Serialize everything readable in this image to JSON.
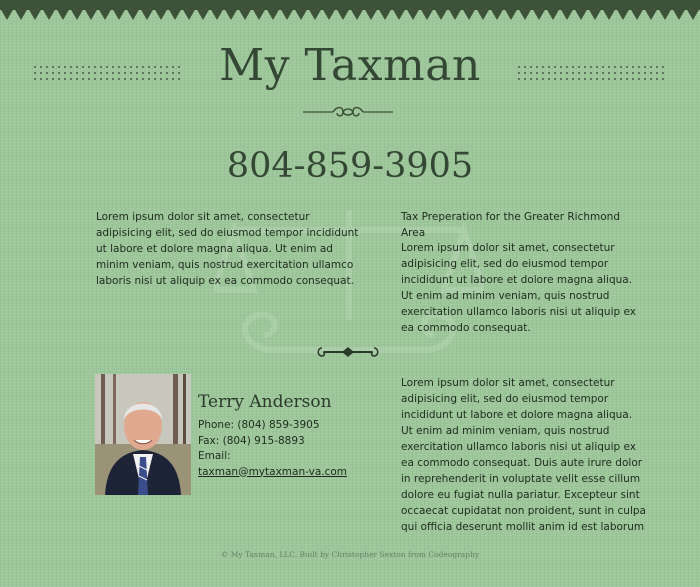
{
  "header": {
    "title": "My Taxman",
    "phone": "804-859-3905"
  },
  "intro": {
    "text": "Lorem ipsum dolor sit amet, consectetur adipisicing elit, sed do eiusmod tempor incididunt ut labore et dolore magna aliqua. Ut enim ad minim veniam, quis nostrud exercitation ullamco laboris nisi ut aliquip ex ea commodo consequat."
  },
  "right_column": {
    "tagline": "Tax Preperation for the Greater Richmond Area",
    "text": "Lorem ipsum dolor sit amet, consectetur adipisicing elit, sed do eiusmod tempor incididunt ut labore et dolore magna aliqua. Ut enim ad minim veniam, quis nostrud exercitation ullamco laboris nisi ut aliquip ex ea commodo consequat."
  },
  "profile": {
    "name": "Terry Anderson",
    "phone": "Phone: (804) 859-3905",
    "fax": "Fax: (804) 915-8893",
    "email_label": "Email:",
    "email": "taxman@mytaxman-va.com"
  },
  "lower_text": "Lorem ipsum dolor sit amet, consectetur adipisicing elit, sed do eiusmod tempor incididunt ut labore et dolore magna aliqua. Ut enim ad minim veniam, quis nostrud exercitation ullamco laboris nisi ut aliquip ex ea commodo consequat. Duis aute irure dolor in reprehenderit in voluptate velit esse cillum dolore eu fugiat nulla pariatur. Excepteur sint occaecat cupidatat non proident, sunt in culpa qui officia deserunt mollit anim id est laborum",
  "footer": "© My Taxman, LLC. Built by Christopher Sexton from Codeography",
  "icons": {
    "divider_top": "flourish-divider-icon",
    "divider_mid": "scroll-divider-icon",
    "watermark": "scales-of-justice-icon"
  },
  "colors": {
    "background": "#9dc79a",
    "heading": "#344734",
    "text": "#1f2b1f",
    "zigzag": "#3d5239"
  }
}
